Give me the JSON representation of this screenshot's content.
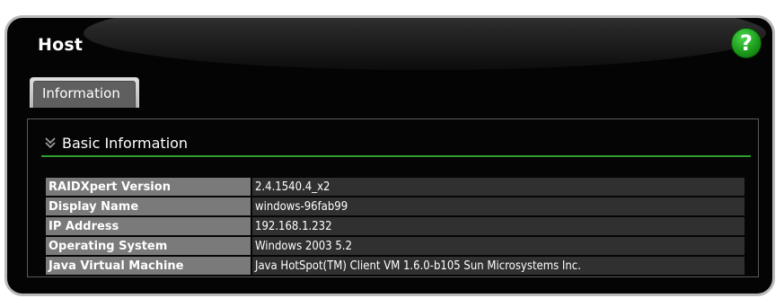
{
  "panel": {
    "title": "Host",
    "help_label": "?"
  },
  "tabs": [
    {
      "label": "Information",
      "selected": true
    }
  ],
  "section": {
    "title": "Basic Information",
    "expanded": true,
    "icon": "double-chevron-down-icon"
  },
  "rows": [
    {
      "label": "RAIDXpert Version",
      "value": "2.4.1540.4_x2"
    },
    {
      "label": "Display Name",
      "value": "windows-96fab99"
    },
    {
      "label": "IP Address",
      "value": "192.168.1.232"
    },
    {
      "label": "Operating System",
      "value": "Windows 2003 5.2"
    },
    {
      "label": "Java Virtual Machine",
      "value": "Java HotSpot(TM) Client VM 1.6.0-b105 Sun Microsystems Inc."
    }
  ],
  "colors": {
    "background": "#040404",
    "help_button": "#1c9c1c",
    "section_underline": "#2e9e2e",
    "label_cell": "#7a7a7a",
    "value_cell": "#303030"
  }
}
